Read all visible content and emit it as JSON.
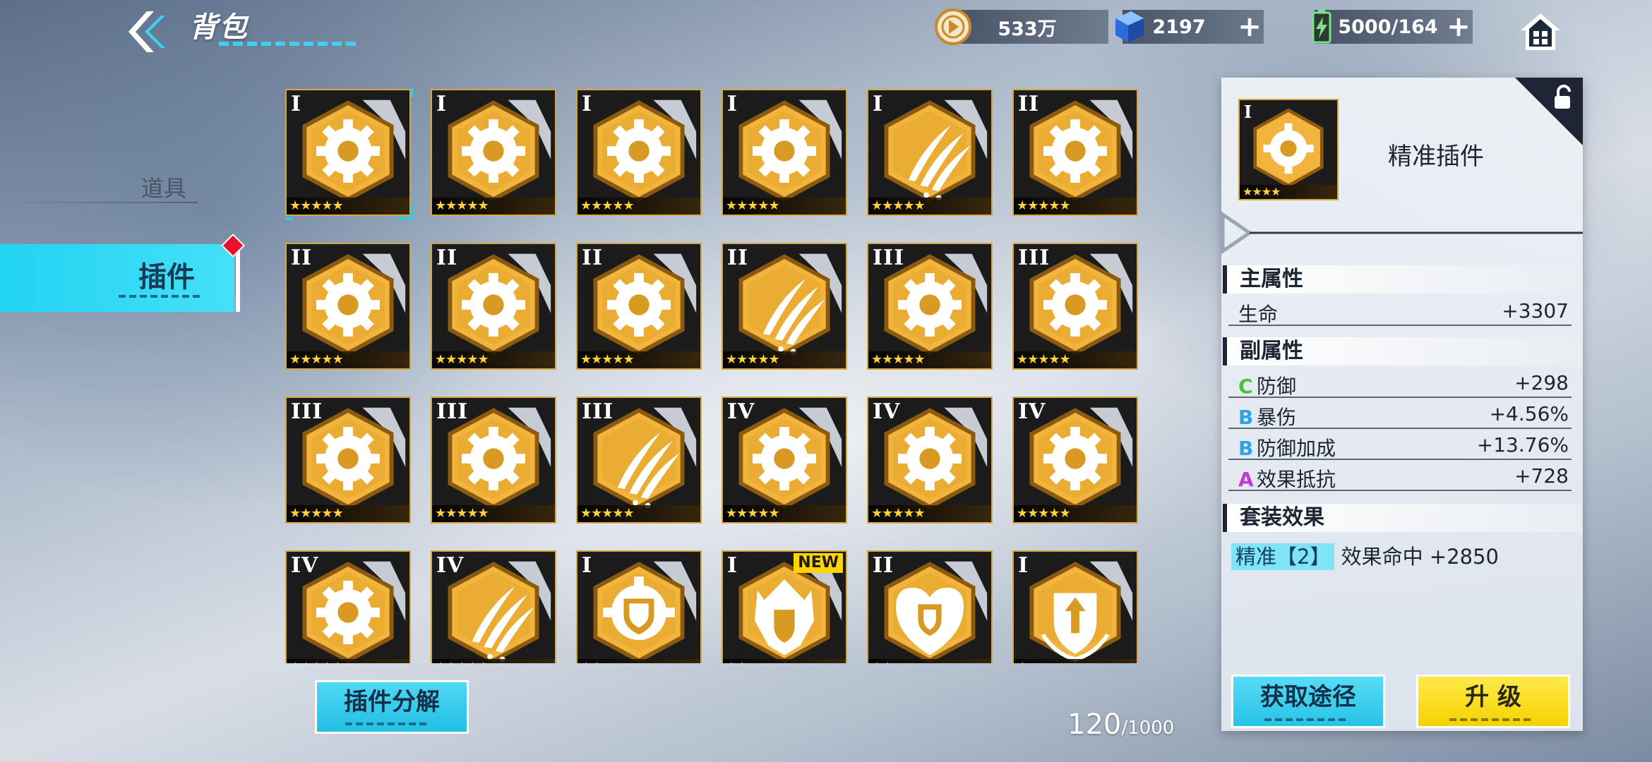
{
  "header": {
    "title": "背包",
    "resources": [
      {
        "icon": "coin-icon",
        "value": "533万",
        "has_plus": false
      },
      {
        "icon": "crystal-icon",
        "value": "2197",
        "has_plus": true
      },
      {
        "icon": "battery-icon",
        "value": "5000/164",
        "has_plus": true
      }
    ]
  },
  "tabs": [
    {
      "label": "道具",
      "active": false
    },
    {
      "label": "插件",
      "active": true
    }
  ],
  "grid": {
    "items": [
      {
        "tier": "I",
        "icon": "gear-icon",
        "stars": "★★★★★"
      },
      {
        "tier": "I",
        "icon": "gear-icon",
        "stars": "★★★★★"
      },
      {
        "tier": "I",
        "icon": "gear-icon",
        "stars": "★★★★★"
      },
      {
        "tier": "I",
        "icon": "gear-icon",
        "stars": "★★★★★"
      },
      {
        "tier": "I",
        "icon": "claw-icon",
        "stars": "★★★★★"
      },
      {
        "tier": "II",
        "icon": "gear-icon",
        "stars": "★★★★★"
      },
      {
        "tier": "II",
        "icon": "gear-icon",
        "stars": "★★★★★"
      },
      {
        "tier": "II",
        "icon": "gear-icon",
        "stars": "★★★★★"
      },
      {
        "tier": "II",
        "icon": "gear-icon",
        "stars": "★★★★★"
      },
      {
        "tier": "II",
        "icon": "claw-icon",
        "stars": "★★★★★"
      },
      {
        "tier": "III",
        "icon": "gear-icon",
        "stars": "★★★★★"
      },
      {
        "tier": "III",
        "icon": "gear-icon",
        "stars": "★★★★★"
      },
      {
        "tier": "III",
        "icon": "gear-icon",
        "stars": "★★★★★"
      },
      {
        "tier": "III",
        "icon": "gear-icon",
        "stars": "★★★★★"
      },
      {
        "tier": "III",
        "icon": "claw-icon",
        "stars": "★★★★★"
      },
      {
        "tier": "IV",
        "icon": "gear-icon",
        "stars": "★★★★★"
      },
      {
        "tier": "IV",
        "icon": "gear-icon",
        "stars": "★★★★★"
      },
      {
        "tier": "IV",
        "icon": "gear-icon",
        "stars": "★★★★★"
      },
      {
        "tier": "IV",
        "icon": "gear-icon",
        "stars": "★★★★★"
      },
      {
        "tier": "IV",
        "icon": "claw-icon",
        "stars": "★★★★★"
      },
      {
        "tier": "I",
        "icon": "gear-shield-icon",
        "stars": "★★"
      },
      {
        "tier": "I",
        "icon": "wing-shield-icon",
        "stars": "★★",
        "badge": "NEW"
      },
      {
        "tier": "II",
        "icon": "heart-shield-icon",
        "stars": "★★"
      },
      {
        "tier": "I",
        "icon": "arrow-shield-icon",
        "stars": "★"
      }
    ]
  },
  "bottom": {
    "decompose_label": "插件分解",
    "capacity_current": "120",
    "capacity_max": "/1000"
  },
  "detail": {
    "name": "精准插件",
    "thumb_tier": "I",
    "thumb_stars": "★★★★",
    "main_title": "主属性",
    "main_stats": [
      {
        "name": "生命",
        "value": "+3307"
      }
    ],
    "sub_title": "副属性",
    "sub_stats": [
      {
        "grade": "C",
        "grade_color": "#44c43a",
        "name": "防御",
        "value": "+298"
      },
      {
        "grade": "B",
        "grade_color": "#2aa6e8",
        "name": "暴伤",
        "value": "+4.56%"
      },
      {
        "grade": "B",
        "grade_color": "#2aa6e8",
        "name": "防御加成",
        "value": "+13.76%"
      },
      {
        "grade": "A",
        "grade_color": "#c03ad8",
        "name": "效果抵抗",
        "value": "+728"
      }
    ],
    "set_title": "套装效果",
    "set_tag": "精准【2】",
    "set_effect": "效果命中 +2850",
    "get_label": "获取途径",
    "upgrade_label": "升 级"
  }
}
